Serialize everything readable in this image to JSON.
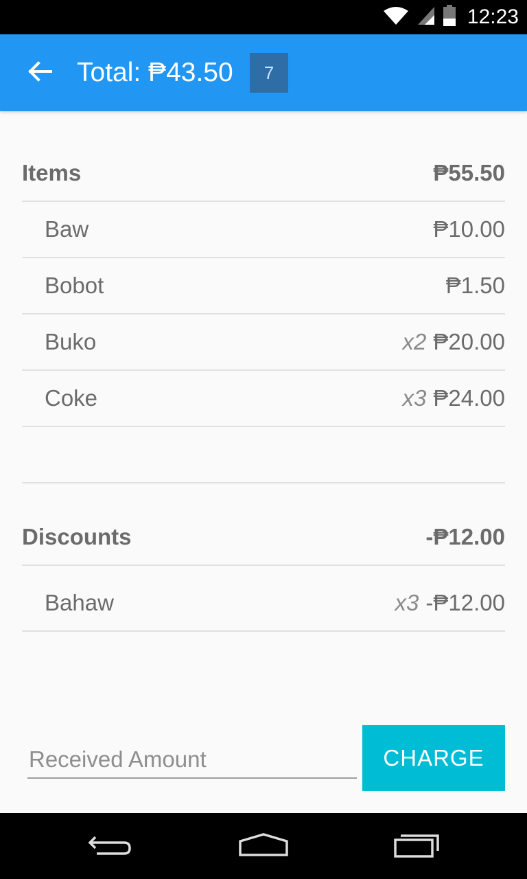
{
  "status_bar": {
    "time": "12:23",
    "icons": [
      "wifi-icon",
      "signal-icon",
      "battery-icon"
    ]
  },
  "app_bar": {
    "title": "Total: ₱43.50",
    "badge": "7",
    "back_icon": "back-arrow-icon"
  },
  "items_section": {
    "label": "Items",
    "total": "₱55.50",
    "rows": [
      {
        "name": "Baw",
        "qty": "",
        "amount": "₱10.00"
      },
      {
        "name": "Bobot",
        "qty": "",
        "amount": "₱1.50"
      },
      {
        "name": "Buko",
        "qty": "x2",
        "amount": "₱20.00"
      },
      {
        "name": "Coke",
        "qty": "x3",
        "amount": "₱24.00"
      }
    ]
  },
  "discounts_section": {
    "label": "Discounts",
    "total": "-₱12.00",
    "rows": [
      {
        "name": "Bahaw",
        "qty": "x3",
        "amount": "-₱12.00"
      }
    ]
  },
  "footer": {
    "received_placeholder": "Received Amount",
    "charge_label": "CHARGE"
  },
  "nav_bar": {
    "icons": [
      "back-nav-icon",
      "home-icon",
      "recents-icon"
    ]
  },
  "colors": {
    "app_bar": "#2196f3",
    "badge": "#2f6da6",
    "charge": "#00bcd4",
    "text": "#6b6b6b"
  }
}
